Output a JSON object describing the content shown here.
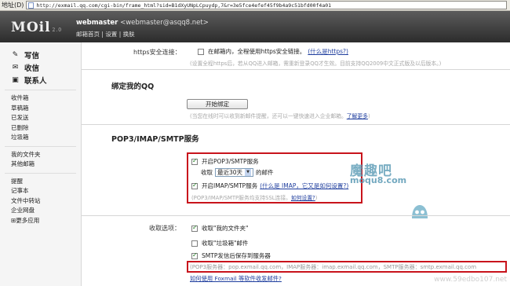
{
  "browser": {
    "address_label": "地址(D)",
    "url": "http://exmail.qq.com/cgi-bin/frame_html?sid=B1dXyUNpLCpuydp,7&r=3e5fce4efef45f9b4a9c51bfd00f4a01"
  },
  "header": {
    "logo": "MOil",
    "logo_suffix": "2.0",
    "user_name": "webmaster",
    "user_email": "<webmaster@asqq8.net>",
    "link_home": "邮箱首页",
    "link_separator": "|",
    "link_settings": "设置",
    "link_switch": "换肤"
  },
  "sidebar": {
    "main": [
      {
        "label": "写信",
        "icon": "pen-icon"
      },
      {
        "label": "收信",
        "icon": "inbox-icon"
      },
      {
        "label": "联系人",
        "icon": "contacts-icon"
      }
    ],
    "folders": [
      "收件箱",
      "草稿箱",
      "已发送",
      "已删除",
      "垃圾箱"
    ],
    "mine": [
      "我的文件夹",
      "其他邮箱"
    ],
    "apps": [
      "提醒",
      "记事本",
      "文件中转站",
      "企业网盘"
    ],
    "more": "更多应用"
  },
  "content": {
    "https": {
      "label": "https安全连接：",
      "option": "在邮箱内，全程使用https安全链接。",
      "link": "(什么是https?)",
      "hint": "(设置全程https后，若从QQ进入邮箱，需重新登录QQ才生效。目前支持QQ2009中文正式版及以后版本。)"
    },
    "qq": {
      "title": "绑定我的QQ",
      "button": "开始绑定",
      "hint": "(当您在线时可以收到新邮件提醒，还可以一键快速进入企业邮箱。",
      "link": "了解更多",
      "hint_end": ")"
    },
    "pop": {
      "title": "POP3/IMAP/SMTP服务",
      "pop3_option": "开启POP3/SMTP服务",
      "receive_label": "收取",
      "receive_value": "最近30天",
      "receive_suffix": "的邮件",
      "imap_option": "开启IMAP/SMTP服务",
      "imap_link": "(什么是 IMAP，它又是如何设置?)",
      "ssl_hint": "(POP3/IMAP/SMTP服务均支持SSL连接。",
      "ssl_link": "如何设置?",
      "ssl_hint_end": ")"
    },
    "receive_options": {
      "label": "收取选项：",
      "opt_my_folders": "收取\"我的文件夹\"",
      "opt_spam": "收取\"垃圾箱\"邮件",
      "opt_smtp_save": "SMTP发信后保存到服务器",
      "servers": "(POP3服务器：pop.exmail.qq.com，IMAP服务器：imap.exmail.qq.com，SMTP服务器：smtp.exmail.qq.com",
      "foxmail_link": "如何使用 Foxmail 等软件收发邮件?"
    },
    "watermark": {
      "title": "魔趣吧",
      "sub": "moqu8.com",
      "corner": "www.59edbo107.net"
    }
  }
}
